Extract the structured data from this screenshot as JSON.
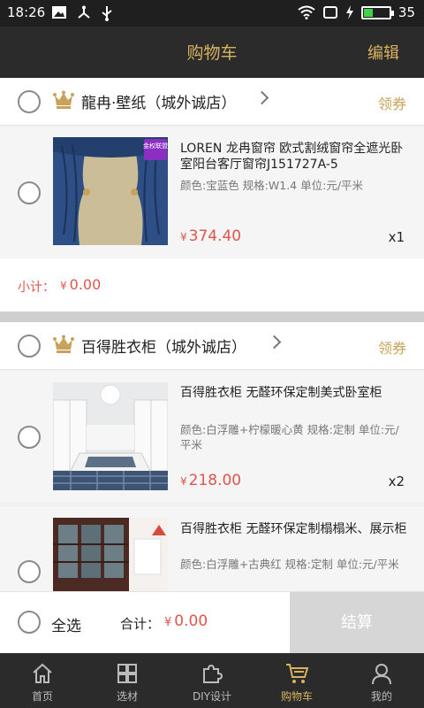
{
  "status_bar": {
    "time": "18:26",
    "battery": "35",
    "battery_level": 0.35
  },
  "header": {
    "title": "购物车",
    "edit": "编辑"
  },
  "stores": [
    {
      "name": "龍冉·壁纸（城外诚店）",
      "coupon": "领券",
      "subtotal_label": "小计：",
      "subtotal_currency": "¥",
      "subtotal_value": "0.00",
      "products": [
        {
          "name": "LOREN 龙冉窗帘 欧式割绒窗帘全遮光卧室阳台客厅窗帘J151727A-5",
          "spec": "颜色:宝蓝色 规格:W1.4 单位:元/平米",
          "currency": "¥",
          "price": "374.40",
          "qty": "x1",
          "badge": "金权联盟"
        }
      ]
    },
    {
      "name": "百得胜衣柜（城外诚店）",
      "coupon": "领券",
      "products": [
        {
          "name": "百得胜衣柜 无醛环保定制美式卧室柜",
          "spec": "颜色:白浮雕+柠檬暖心黄 规格:定制 单位:元/平米",
          "currency": "¥",
          "price": "218.00",
          "qty": "x2"
        },
        {
          "name": "百得胜衣柜 无醛环保定制榻榻米、展示柜",
          "spec": "颜色:白浮雕+古典红 规格:定制 单位:元/平米"
        }
      ]
    }
  ],
  "checkout": {
    "select_all": "全选",
    "total_label": "合计：",
    "currency": "¥",
    "total_value": "0.00",
    "pay_button": "结算"
  },
  "tabs": [
    {
      "label": "首页",
      "icon": "home-icon"
    },
    {
      "label": "选材",
      "icon": "grid-icon"
    },
    {
      "label": "DIY设计",
      "icon": "puzzle-icon"
    },
    {
      "label": "购物车",
      "icon": "cart-icon",
      "active": true
    },
    {
      "label": "我的",
      "icon": "user-icon"
    }
  ],
  "colors": {
    "accent_gold": "#d8b25f",
    "price_red": "#e0554b",
    "dark_bar": "#2b2b2b",
    "pay_disabled": "#d6d6d6"
  }
}
